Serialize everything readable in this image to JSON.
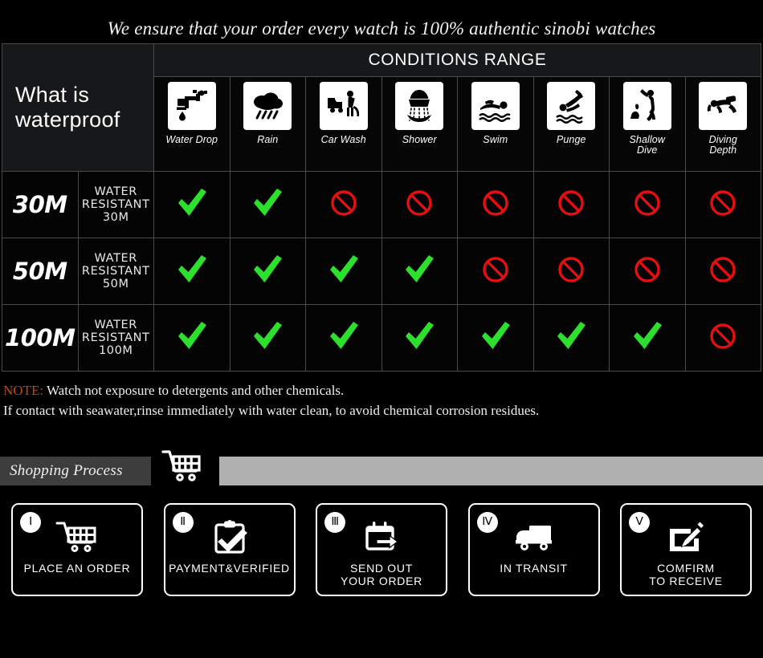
{
  "headline": "We ensure that your order every watch is 100% authentic sinobi watches",
  "table": {
    "left_header": "What is waterproof",
    "conditions_title": "CONDITIONS RANGE",
    "columns": [
      {
        "label": "Water Drop",
        "icon": "faucet-icon"
      },
      {
        "label": "Rain",
        "icon": "rain-cloud-icon"
      },
      {
        "label": "Car Wash",
        "icon": "car-wash-icon"
      },
      {
        "label": "Shower",
        "icon": "shower-icon"
      },
      {
        "label": "Swim",
        "icon": "swimmer-icon"
      },
      {
        "label": "Punge",
        "icon": "plunge-dive-icon"
      },
      {
        "label": "Shallow\nDive",
        "icon": "shallow-dive-icon"
      },
      {
        "label": "Diving\nDepth",
        "icon": "scuba-diver-icon"
      }
    ],
    "rows": [
      {
        "rating": "30M",
        "description": "WATER RESISTANT  30M",
        "marks": [
          "yes",
          "yes",
          "no",
          "no",
          "no",
          "no",
          "no",
          "no"
        ]
      },
      {
        "rating": "50M",
        "description": "WATER RESISTANT 50M",
        "marks": [
          "yes",
          "yes",
          "yes",
          "yes",
          "no",
          "no",
          "no",
          "no"
        ]
      },
      {
        "rating": "100M",
        "description": "WATER RESISTANT  100M",
        "marks": [
          "yes",
          "yes",
          "yes",
          "yes",
          "yes",
          "yes",
          "yes",
          "no"
        ]
      }
    ],
    "mark_colors": {
      "yes": "#2ee02e",
      "no": "#e60f0f"
    }
  },
  "note": {
    "tag": "NOTE:",
    "line1": " Watch not exposure to detergents and other chemicals.",
    "line2": "If contact with seawater,rinse immediately with water clean, to avoid chemical corrosion residues.",
    "tag_color": "#c2461d"
  },
  "process": {
    "band_title": "Shopping Process",
    "band_icon": "shopping-cart-icon",
    "band_dark_color": "#3d3d3d",
    "band_light_color": "#b0b0b0",
    "steps": [
      {
        "numeral": "Ⅰ",
        "label": "PLACE AN ORDER",
        "icon": "shopping-cart-icon"
      },
      {
        "numeral": "Ⅱ",
        "label": "PAYMENT&VERIFIED",
        "icon": "clipboard-check-icon"
      },
      {
        "numeral": "Ⅲ",
        "label": "SEND OUT\nYOUR ORDER",
        "icon": "box-arrow-out-icon"
      },
      {
        "numeral": "Ⅳ",
        "label": "IN TRANSIT",
        "icon": "delivery-truck-icon"
      },
      {
        "numeral": "Ⅴ",
        "label": "COMFIRM\nTO RECEIVE",
        "icon": "sign-receipt-icon"
      }
    ]
  }
}
